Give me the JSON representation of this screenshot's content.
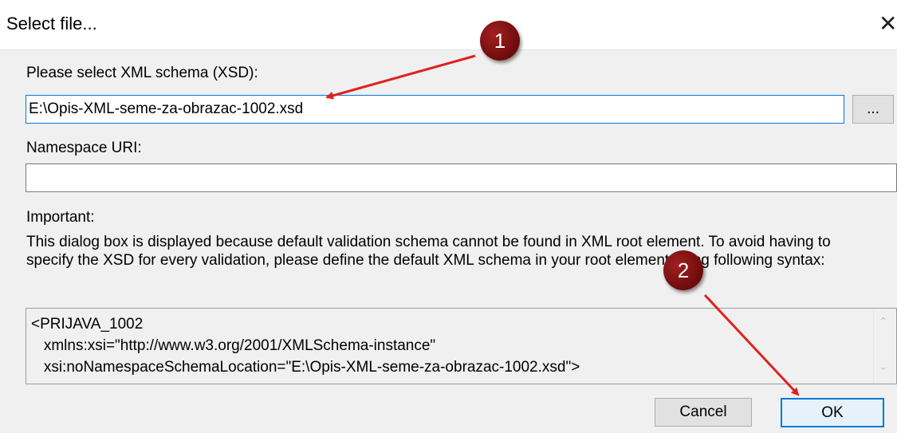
{
  "dialog": {
    "title": "Select file...",
    "close_glyph": "✕"
  },
  "form": {
    "xsd_label": "Please select XML schema (XSD):",
    "xsd_value": "E:\\Opis-XML-seme-za-obrazac-1002.xsd",
    "browse_label": "...",
    "namespace_label": "Namespace URI:",
    "namespace_value": ""
  },
  "info": {
    "heading": "Important:",
    "text": "This dialog box is displayed because default validation schema cannot be found in XML root element. To avoid having to specify the XSD for every validation, please define the default XML schema in your root element using following syntax:",
    "code_lines": [
      "<PRIJAVA_1002",
      "   xmlns:xsi=\"http://www.w3.org/2001/XMLSchema-instance\"",
      "   xsi:noNamespaceSchemaLocation=\"E:\\Opis-XML-seme-za-obrazac-1002.xsd\">"
    ]
  },
  "buttons": {
    "cancel": "Cancel",
    "ok": "OK"
  },
  "annotations": {
    "marker1": "1",
    "marker2": "2",
    "color": "#e02020"
  }
}
